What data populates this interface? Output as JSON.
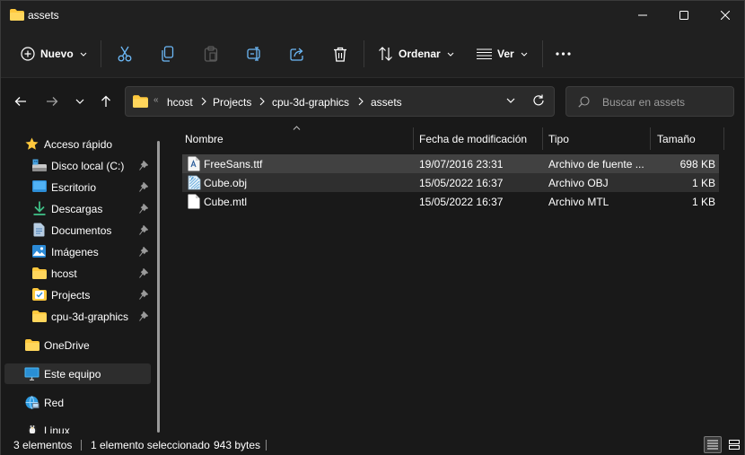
{
  "window": {
    "title": "assets"
  },
  "toolbar": {
    "new_label": "Nuevo",
    "sort_label": "Ordenar",
    "view_label": "Ver",
    "icons": [
      "plus-circle-icon",
      "scissors-icon",
      "copy-icon",
      "paste-icon",
      "rename-icon",
      "share-icon",
      "trash-icon",
      "sort-icon",
      "view-lines-icon",
      "more-icon"
    ]
  },
  "address": {
    "crumbs": [
      "hcost",
      "Projects",
      "cpu-3d-graphics",
      "assets"
    ],
    "overflow": "«"
  },
  "search": {
    "placeholder": "Buscar en assets"
  },
  "sidebar": {
    "items": [
      {
        "label": "Acceso rápido",
        "icon": "star-icon"
      },
      {
        "label": "Disco local (C:)",
        "icon": "drive-icon",
        "pinned": true
      },
      {
        "label": "Escritorio",
        "icon": "desktop-icon",
        "pinned": true
      },
      {
        "label": "Descargas",
        "icon": "download-icon",
        "pinned": true
      },
      {
        "label": "Documentos",
        "icon": "documents-icon",
        "pinned": true
      },
      {
        "label": "Imágenes",
        "icon": "pictures-icon",
        "pinned": true
      },
      {
        "label": "hcost",
        "icon": "folder-icon",
        "pinned": true
      },
      {
        "label": "Projects",
        "icon": "projects-folder-icon",
        "pinned": true
      },
      {
        "label": "cpu-3d-graphics",
        "icon": "folder-icon",
        "pinned": true
      },
      {
        "label": "OneDrive",
        "icon": "folder-icon"
      },
      {
        "label": "Este equipo",
        "icon": "computer-icon",
        "selected": true
      },
      {
        "label": "Red",
        "icon": "network-icon"
      },
      {
        "label": "Linux",
        "icon": "linux-icon"
      }
    ]
  },
  "columns": [
    "Nombre",
    "Fecha de modificación",
    "Tipo",
    "Tamaño"
  ],
  "files": [
    {
      "name": "FreeSans.ttf",
      "date": "19/07/2016 23:31",
      "type": "Archivo de fuente ...",
      "size": "698 KB",
      "icon": "font-file-icon",
      "state": "selected"
    },
    {
      "name": "Cube.obj",
      "date": "15/05/2022 16:37",
      "type": "Archivo OBJ",
      "size": "1 KB",
      "icon": "obj-file-icon",
      "state": "hover"
    },
    {
      "name": "Cube.mtl",
      "date": "15/05/2022 16:37",
      "type": "Archivo MTL",
      "size": "1 KB",
      "icon": "blank-file-icon",
      "state": "normal"
    }
  ],
  "status": {
    "count": "3 elementos",
    "selection": "1 elemento seleccionado",
    "size": "943 bytes"
  },
  "colors": {
    "accent": "#ffc83d",
    "selection": "#414141",
    "background": "#191919"
  }
}
